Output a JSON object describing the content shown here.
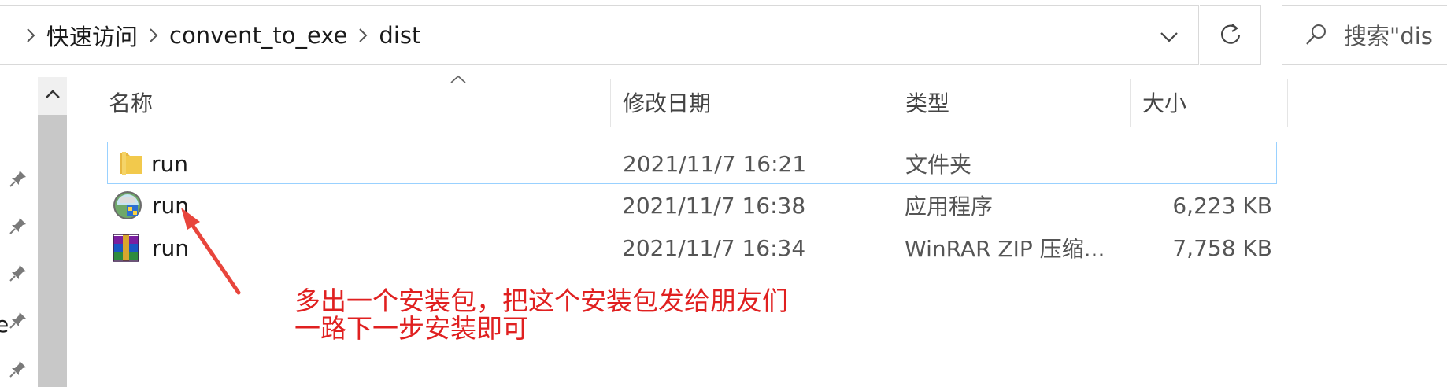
{
  "address_bar": {
    "breadcrumbs": [
      "快速访问",
      "convent_to_exe",
      "dist"
    ]
  },
  "search": {
    "placeholder": "搜索\"dis"
  },
  "columns": [
    {
      "key": "name",
      "label": "名称"
    },
    {
      "key": "modified",
      "label": "修改日期"
    },
    {
      "key": "type",
      "label": "类型"
    },
    {
      "key": "size",
      "label": "大小"
    }
  ],
  "files": [
    {
      "name": "run",
      "modified": "2021/11/7 16:21",
      "type": "文件夹",
      "size": "",
      "icon": "folder-icon",
      "selected": true
    },
    {
      "name": "run",
      "modified": "2021/11/7 16:38",
      "type": "应用程序",
      "size": "6,223 KB",
      "icon": "exe-app-icon",
      "selected": false
    },
    {
      "name": "run",
      "modified": "2021/11/7 16:34",
      "type": "WinRAR ZIP 压缩...",
      "size": "7,758 KB",
      "icon": "winrar-archive-icon",
      "selected": false
    }
  ],
  "nav_pane": {
    "partial_label": "e"
  },
  "annotation": {
    "lines": [
      "多出一个安装包，把这个安装包发给朋友们",
      "一路下一步安装即可"
    ],
    "color": "#e02020"
  },
  "colors": {
    "selection_border": "#99d1ff",
    "scrollbar_thumb": "#c8c8c8"
  }
}
